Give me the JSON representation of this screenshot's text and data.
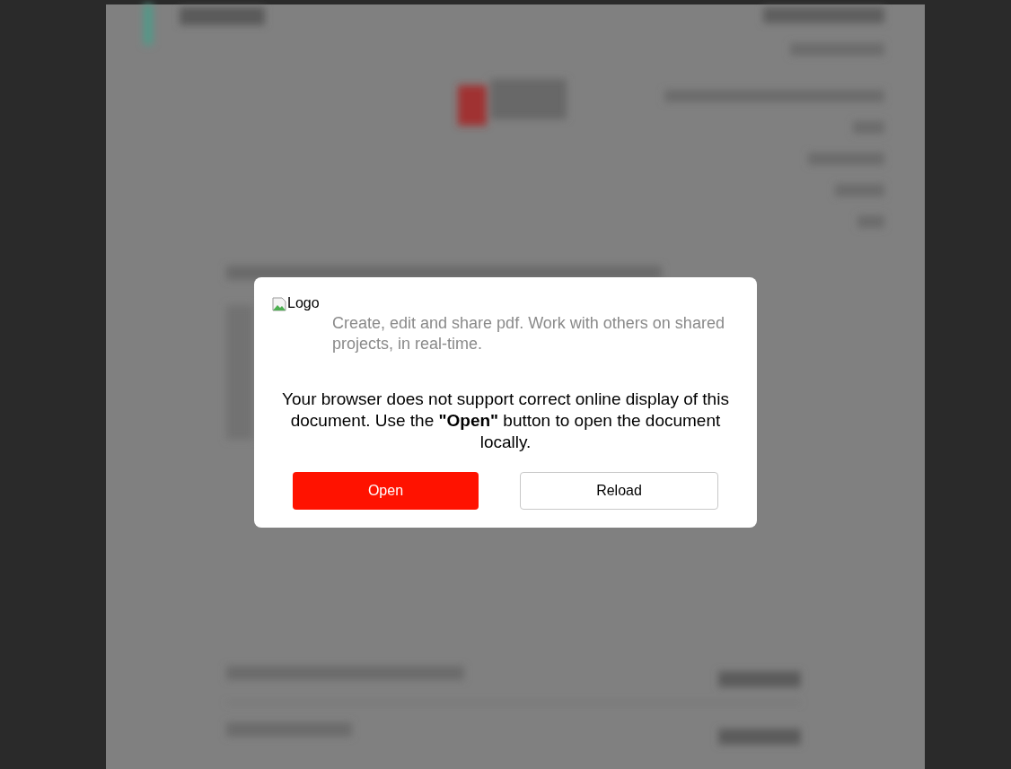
{
  "dialog": {
    "logo_alt": "Logo",
    "tagline": "Create, edit and share pdf. Work with others on shared projects, in real-time.",
    "message": "Your browser does not support correct online display of this document. Use the **\"Open\"** button to open the document locally.",
    "buttons": [
      {
        "label": "Open",
        "kind": "primary"
      },
      {
        "label": "Reload",
        "kind": "secondary"
      }
    ]
  }
}
